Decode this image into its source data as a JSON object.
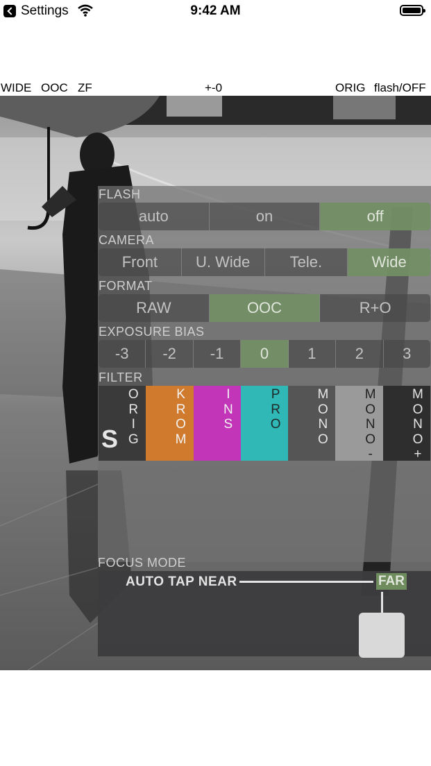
{
  "status_bar": {
    "back_app": "Settings",
    "time": "9:42 AM",
    "icons": [
      "back-arrow-icon",
      "wifi-icon",
      "battery-icon"
    ]
  },
  "toolbar": {
    "lens": "WIDE",
    "format": "OOC",
    "zoom": "ZF",
    "exposure": "+-0",
    "filter": "ORIG",
    "flash": "flash/OFF"
  },
  "panel": {
    "flash": {
      "title": "FLASH",
      "options": [
        "auto",
        "on",
        "off"
      ],
      "selected": "off"
    },
    "camera": {
      "title": "CAMERA",
      "options": [
        "Front",
        "U. Wide",
        "Tele.",
        "Wide"
      ],
      "selected": "Wide"
    },
    "format": {
      "title": "FORMAT",
      "options": [
        "RAW",
        "OOC",
        "R+O"
      ],
      "selected": "OOC"
    },
    "exposure": {
      "title": "EXPOSURE BIAS",
      "options": [
        "-3",
        "-2",
        "-1",
        "0",
        "1",
        "2",
        "3"
      ],
      "selected": "0"
    },
    "filter": {
      "title": "FILTER",
      "badge": "S",
      "options": [
        {
          "label": "ORIG",
          "color": "#3a3a3a"
        },
        {
          "label": "KROM",
          "color": "#d07a2d"
        },
        {
          "label": "INS",
          "color": "#c235b8"
        },
        {
          "label": "PRO",
          "color": "#2fb8b5"
        },
        {
          "label": "MONO",
          "color": "#555555"
        },
        {
          "label": "MONO-",
          "color": "#9a9a9a"
        },
        {
          "label": "MONO+",
          "color": "#2e2e2e"
        }
      ]
    },
    "focus": {
      "title": "FOCUS MODE",
      "labels": "AUTO TAP NEAR",
      "far": "FAR"
    }
  }
}
